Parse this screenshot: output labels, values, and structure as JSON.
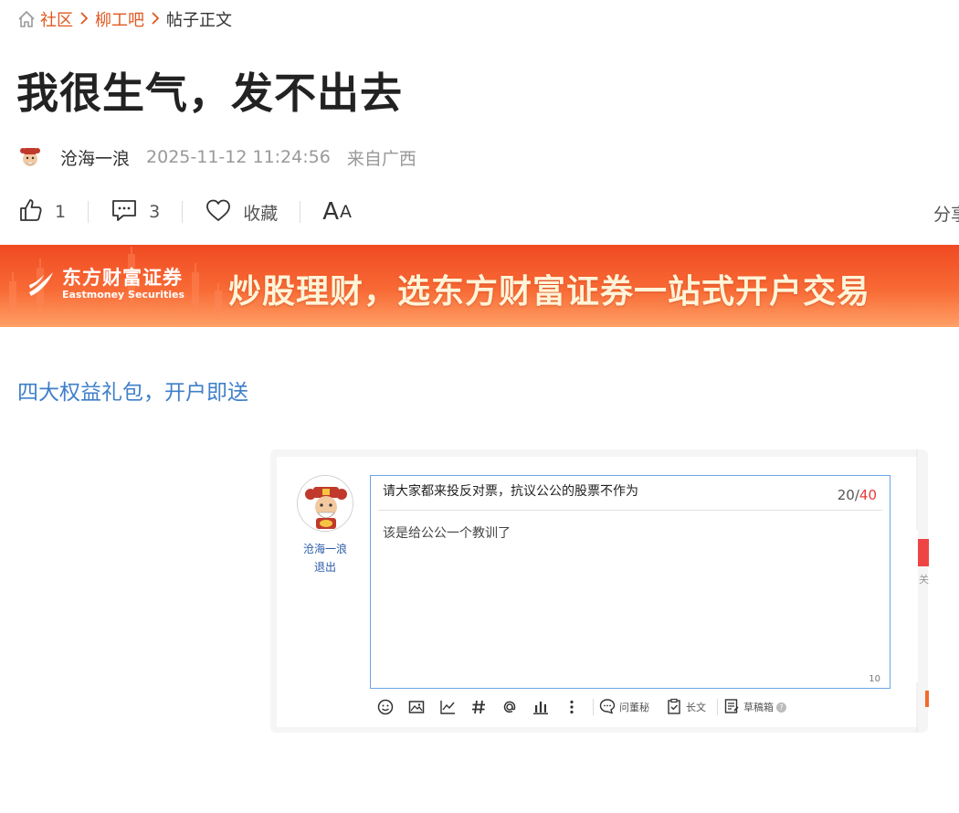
{
  "breadcrumb": {
    "items": [
      "社区",
      "柳工吧",
      "帖子正文"
    ]
  },
  "post": {
    "title": "我很生气，发不出去",
    "author": "沧海一浪",
    "time": "2025-11-12 11:24:56",
    "location": "来自广西"
  },
  "actions": {
    "like_count": "1",
    "comment_count": "3",
    "favorite_label": "收藏",
    "font_size_label_big": "A",
    "font_size_label_small": "A",
    "share_label": "分享"
  },
  "banner": {
    "logo_cn": "东方财富证券",
    "logo_en": "Eastmoney Securities",
    "slogan": "炒股理财，选东方财富证券一站式开户交易"
  },
  "promo": {
    "link_text": "四大权益礼包，开户即送"
  },
  "reply": {
    "username": "沧海一浪",
    "logout": "退出",
    "title_value": "请大家都来投反对票，抗议公公的股票不作为",
    "title_count": "20/",
    "title_max": "40",
    "body_value": "该是给公公一个教训了",
    "body_count": "10",
    "toolbar": {
      "ask_label": "问董秘",
      "longtext_label": "长文",
      "draft_label": "草稿箱",
      "help": "?"
    }
  },
  "side": {
    "text": "关"
  },
  "colors": {
    "link_orange": "#e0581f",
    "promo_blue": "#3f7fc9",
    "banner_top": "#f04a22",
    "banner_bottom": "#ffa066",
    "counter_red": "#e53b3b",
    "editor_border": "#6aa5e6"
  },
  "icons": {
    "home": "home-icon",
    "chevron": "chevron-right-icon",
    "like": "thumbs-up-icon",
    "comment": "comment-icon",
    "favorite": "heart-icon"
  }
}
